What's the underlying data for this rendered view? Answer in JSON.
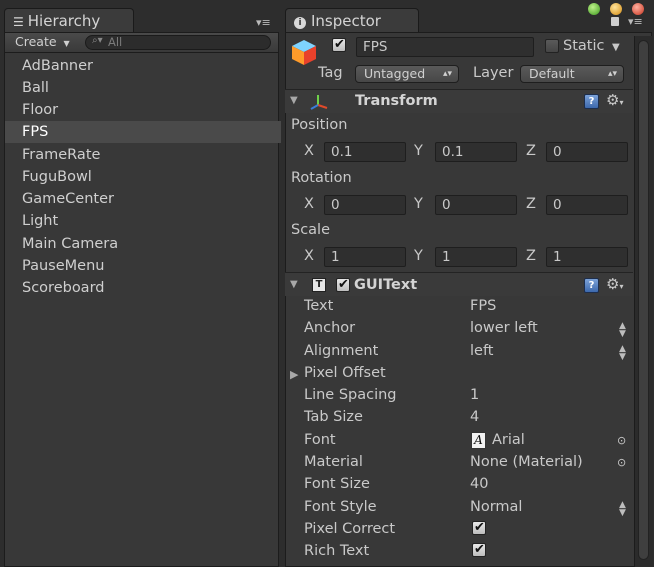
{
  "hierarchy": {
    "tab_label": "Hierarchy",
    "create_label": "Create",
    "search_placeholder": "All",
    "items": [
      "AdBanner",
      "Ball",
      "Floor",
      "FPS",
      "FrameRate",
      "FuguBowl",
      "GameCenter",
      "Light",
      "Main Camera",
      "PauseMenu",
      "Scoreboard"
    ],
    "selected_index": 3
  },
  "inspector": {
    "tab_label": "Inspector",
    "object_name": "FPS",
    "object_active": true,
    "static_label": "Static",
    "static_checked": false,
    "tag_label": "Tag",
    "tag_value": "Untagged",
    "layer_label": "Layer",
    "layer_value": "Default",
    "transform": {
      "title": "Transform",
      "position_label": "Position",
      "rotation_label": "Rotation",
      "scale_label": "Scale",
      "axis_x": "X",
      "axis_y": "Y",
      "axis_z": "Z",
      "position": {
        "x": "0.1",
        "y": "0.1",
        "z": "0"
      },
      "rotation": {
        "x": "0",
        "y": "0",
        "z": "0"
      },
      "scale": {
        "x": "1",
        "y": "1",
        "z": "1"
      }
    },
    "guitext": {
      "title": "GUIText",
      "enabled": true,
      "icon_letter": "T",
      "props": [
        {
          "label": "Text",
          "value": "FPS"
        },
        {
          "label": "Anchor",
          "value": "lower left"
        },
        {
          "label": "Alignment",
          "value": "left"
        },
        {
          "label": "Pixel Offset",
          "value": ""
        },
        {
          "label": "Line Spacing",
          "value": "1"
        },
        {
          "label": "Tab Size",
          "value": "4"
        },
        {
          "label": "Font",
          "value": "Arial"
        },
        {
          "label": "Material",
          "value": "None (Material)"
        },
        {
          "label": "Font Size",
          "value": "40"
        },
        {
          "label": "Font Style",
          "value": "Normal"
        },
        {
          "label": "Pixel Correct",
          "value": ""
        },
        {
          "label": "Rich Text",
          "value": ""
        }
      ],
      "pixel_correct": true,
      "rich_text": true
    }
  },
  "colors": {
    "panel": "#383838",
    "selection": "#4a4a4a",
    "accent_help": "#3d69ad"
  }
}
